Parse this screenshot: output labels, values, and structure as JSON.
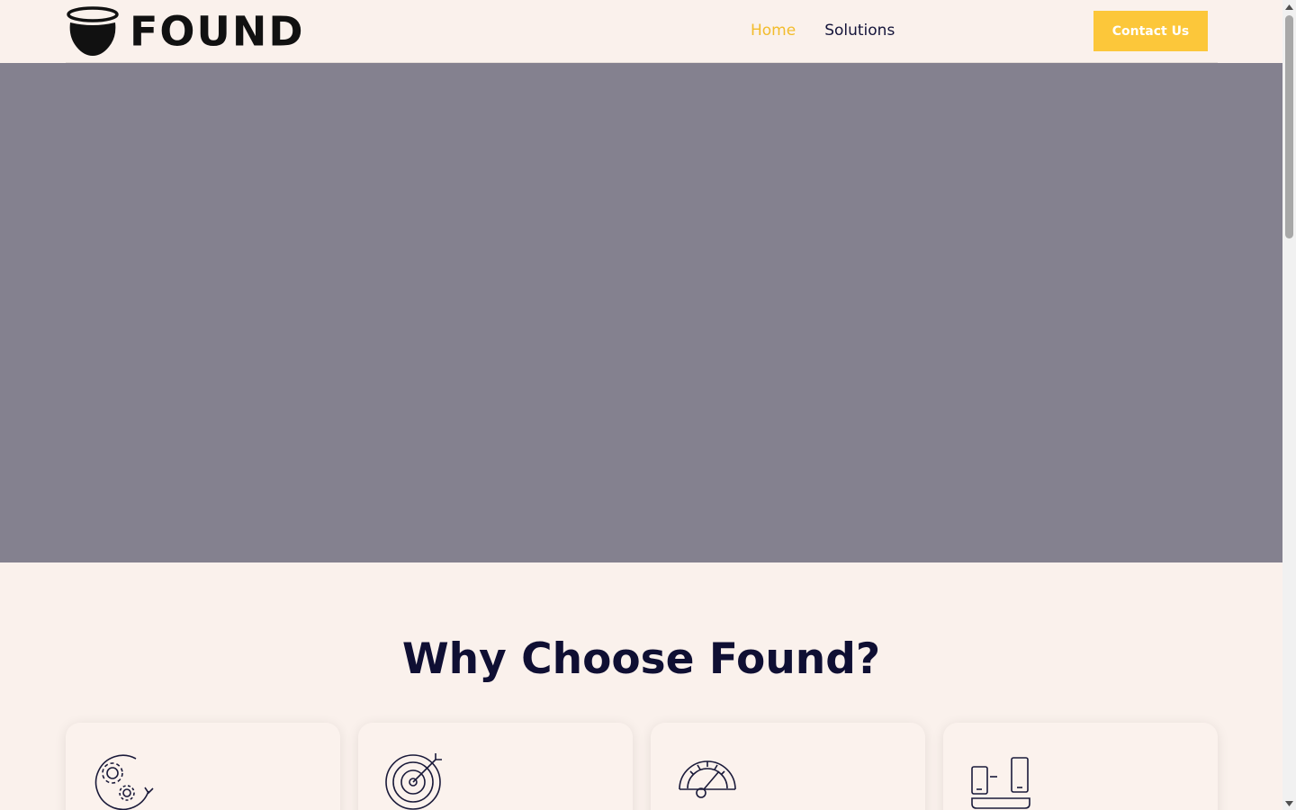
{
  "brand": {
    "name": "FOUND"
  },
  "nav": {
    "items": [
      {
        "label": "Home",
        "active": true
      },
      {
        "label": "Solutions",
        "active": false
      }
    ]
  },
  "header": {
    "contact_label": "Contact Us"
  },
  "why": {
    "title": "Why Choose Found?",
    "cards": [
      {
        "icon": "gears-cycle-icon"
      },
      {
        "icon": "target-icon"
      },
      {
        "icon": "speedometer-icon"
      },
      {
        "icon": "devices-icon"
      }
    ]
  },
  "colors": {
    "accent": "#fcc73a",
    "nav_active": "#f2bc2c",
    "hero_bg": "#84818f",
    "page_bg": "#faf1ec",
    "text_dark": "#0f0f33"
  }
}
